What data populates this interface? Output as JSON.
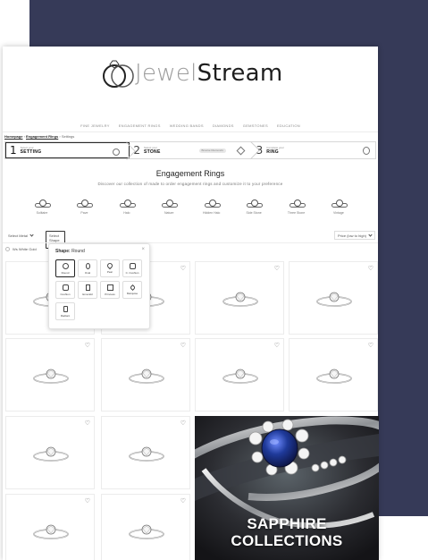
{
  "brand": {
    "name_part1": "Jewel",
    "name_part2": "Stream"
  },
  "topnav": [
    "Fine Jewelry",
    "Engagement Rings",
    "Wedding Bands",
    "Diamonds",
    "Gemstones",
    "Education"
  ],
  "breadcrumb": {
    "home": "Homepage",
    "parent": "Engagement Rings",
    "current": "Settings"
  },
  "steps": [
    {
      "num": "1",
      "small": "Select your",
      "big": "SETTING"
    },
    {
      "num": "2",
      "small": "Select your",
      "big": "STONE",
      "pill": "Browse Diamonds"
    },
    {
      "num": "3",
      "small": "Complete your",
      "big": "RING"
    }
  ],
  "page": {
    "title": "Engagement Rings",
    "subtitle": "Discover our collection of made to order engagement rings and customize it to your preference"
  },
  "ring_styles": [
    "Solitaire",
    "Pave",
    "Halo",
    "Nature",
    "Hidden Halo",
    "Side Stone",
    "Three Stone",
    "Vintage"
  ],
  "filters": {
    "metal": "Select Metal",
    "shape": "Select Shape",
    "sort": "Price (low to high)",
    "metal_toggle": "Ws White Gold"
  },
  "shape_popup": {
    "label": "Shape:",
    "value": "Round",
    "close": "×",
    "shapes": [
      "Round",
      "Oval",
      "Pear",
      "C. Cushion",
      "Cushion",
      "Emerald",
      "Princess",
      "Marquise",
      "Radiant"
    ],
    "selected": "Round"
  },
  "promo": {
    "line1": "SAPPHIRE",
    "line2": "COLLECTIONS"
  },
  "colors": {
    "navy_background": "#363a58",
    "sapphire": "#1f3a9a"
  }
}
